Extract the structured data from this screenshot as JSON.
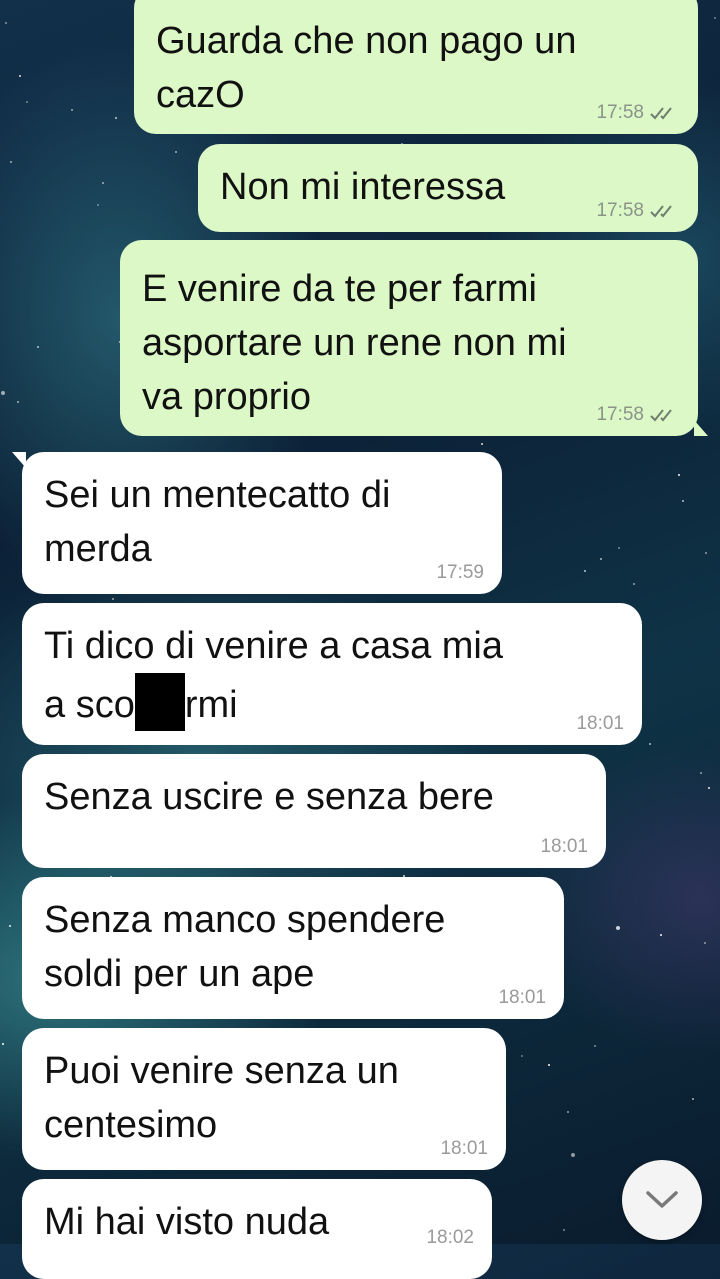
{
  "messages": [
    {
      "dir": "out",
      "text": "Guarda che non pago un\ncazO",
      "time": "17:58",
      "status": "read"
    },
    {
      "dir": "out",
      "text": "Non mi interessa",
      "time": "17:58",
      "status": "read"
    },
    {
      "dir": "out",
      "text": "E venire da te per farmi\nasportare un rene non mi\nva proprio",
      "time": "17:58",
      "status": "read"
    },
    {
      "dir": "in",
      "text": "Sei un mentecatto di\nmerda",
      "time": "17:59"
    },
    {
      "dir": "in",
      "text_before": "Ti dico di venire a casa mia\na sco",
      "text_after": "rmi",
      "time": "18:01",
      "redacted": true
    },
    {
      "dir": "in",
      "text": "Senza uscire e senza bere",
      "time": "18:01"
    },
    {
      "dir": "in",
      "text": "Senza manco spendere\nsoldi per un ape",
      "time": "18:01"
    },
    {
      "dir": "in",
      "text": "Puoi venire senza un\ncentesimo",
      "time": "18:01"
    },
    {
      "dir": "in",
      "text": "Mi hai visto nuda",
      "time": "18:02"
    }
  ],
  "scroll_button": {
    "icon": "chevron-down-icon"
  },
  "colors": {
    "outgoing": "#dcf8c6",
    "incoming": "#ffffff",
    "tick": "#6e7d6e"
  }
}
